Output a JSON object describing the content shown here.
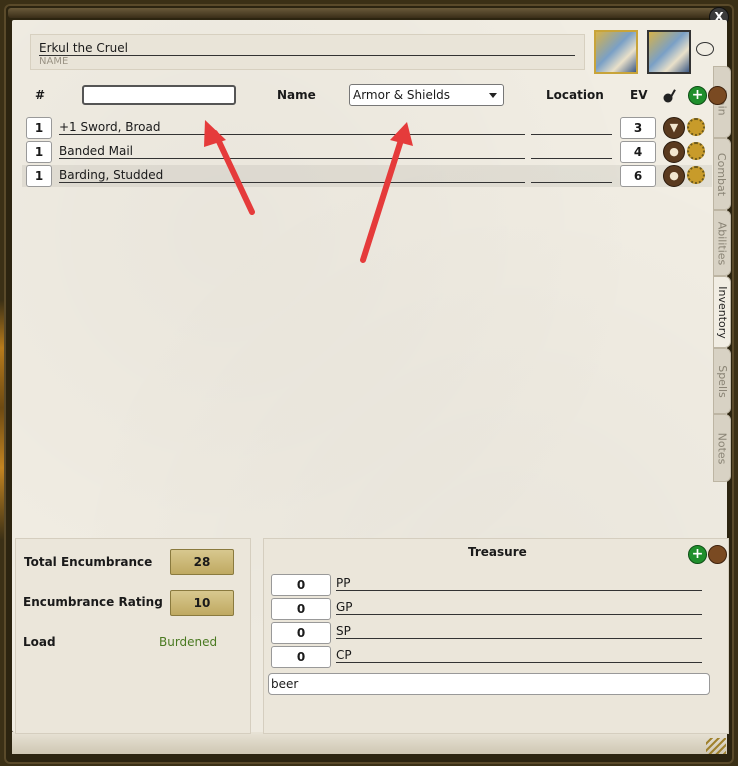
{
  "window": {
    "close_label": "X"
  },
  "header": {
    "name_value": "Erkul the Cruel",
    "name_label": "NAME"
  },
  "tabs": [
    {
      "label": "Main",
      "active": false
    },
    {
      "label": "Combat",
      "active": false
    },
    {
      "label": "Abilities",
      "active": false
    },
    {
      "label": "Inventory",
      "active": true
    },
    {
      "label": "Spells",
      "active": false
    },
    {
      "label": "Notes",
      "active": false
    }
  ],
  "inventory": {
    "columns": {
      "count": "#",
      "name": "Name",
      "location": "Location",
      "ev": "EV"
    },
    "filter_text": "",
    "filter_select": "Armor & Shields",
    "items": [
      {
        "count": "1",
        "name": "+1 Sword, Broad",
        "location": "",
        "ev": "3",
        "carried_icon": "armor-icon"
      },
      {
        "count": "1",
        "name": "Banded Mail",
        "location": "",
        "ev": "4",
        "carried_icon": "bag-icon"
      },
      {
        "count": "1",
        "name": "Barding, Studded",
        "location": "",
        "ev": "6",
        "carried_icon": "bag-icon"
      }
    ]
  },
  "encumbrance": {
    "total_label": "Total Encumbrance",
    "total_value": "28",
    "rating_label": "Encumbrance Rating",
    "rating_value": "10",
    "load_label": "Load",
    "load_value": "Burdened"
  },
  "treasure": {
    "title": "Treasure",
    "coins": [
      {
        "amount": "0",
        "label": "PP"
      },
      {
        "amount": "0",
        "label": "GP"
      },
      {
        "amount": "0",
        "label": "SP"
      },
      {
        "amount": "0",
        "label": "CP"
      }
    ],
    "notes": "beer"
  },
  "colors": {
    "arrow": "#e53b3b",
    "load_text": "#4a7a21",
    "add_button": "#1f8f2c"
  }
}
